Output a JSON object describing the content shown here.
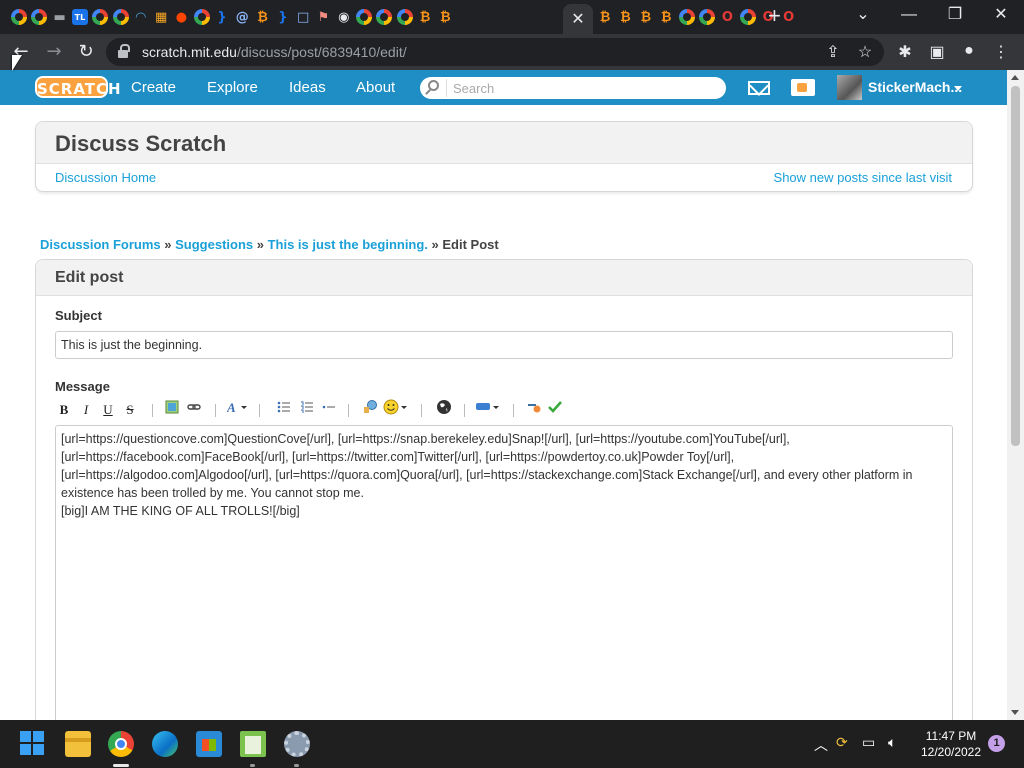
{
  "browser": {
    "url_host": "scratch.mit.edu",
    "url_path": "/discuss/post/6839410/edit/",
    "tabs": [
      {
        "icon": "google-icon"
      },
      {
        "icon": "google-icon"
      },
      {
        "icon": "monitor-icon"
      },
      {
        "icon": "tl-icon",
        "text": "TL"
      },
      {
        "icon": "google-icon"
      },
      {
        "icon": "google-icon"
      },
      {
        "icon": "wifi-icon"
      },
      {
        "icon": "grid-icon"
      },
      {
        "icon": "reddit-icon"
      },
      {
        "icon": "google-icon"
      },
      {
        "icon": "brace-icon"
      },
      {
        "icon": "at-icon"
      },
      {
        "icon": "bitcoin-icon"
      },
      {
        "icon": "brace-icon"
      },
      {
        "icon": "square-icon"
      },
      {
        "icon": "flag-icon"
      },
      {
        "icon": "chrome-icon"
      },
      {
        "icon": "google-icon"
      },
      {
        "icon": "google-icon"
      },
      {
        "icon": "google-icon"
      },
      {
        "icon": "bitcoin-icon"
      },
      {
        "icon": "bitcoin-icon"
      },
      {
        "icon": "bitcoin-icon"
      },
      {
        "icon": "bitcoin-icon"
      },
      {
        "icon": "bitcoin-icon"
      },
      {
        "icon": "bitcoin-icon"
      },
      {
        "icon": "google-icon"
      },
      {
        "icon": "google-icon"
      },
      {
        "icon": "opera-icon"
      },
      {
        "icon": "google-icon"
      },
      {
        "icon": "opera-icon"
      },
      {
        "icon": "opera-icon"
      }
    ]
  },
  "scratch_nav": {
    "logo_text": "SCRATCH",
    "links": [
      "Create",
      "Explore",
      "Ideas",
      "About"
    ],
    "search_placeholder": "Search",
    "username": "StickerMach..."
  },
  "discuss": {
    "title": "Discuss Scratch",
    "home_link": "Discussion Home",
    "new_posts_link": "Show new posts since last visit"
  },
  "breadcrumb": {
    "forums": "Discussion Forums",
    "sep": " » ",
    "category": "Suggestions",
    "topic": "This is just the beginning.",
    "current": " » Edit Post"
  },
  "edit_post": {
    "heading": "Edit post",
    "subject_label": "Subject",
    "subject_value": "This is just the beginning.",
    "message_label": "Message",
    "message_value": "[url=https://questioncove.com]QuestionCove[/url], [url=https://snap.berekeley.edu]Snap![/url], [url=https://youtube.com]YouTube[/url], [url=https://facebook.com]FaceBook[/url], [url=https://twitter.com]Twitter[/url], [url=https://powdertoy.co.uk]Powder Toy[/url], [url=https://algodoo.com]Algodoo[/url], [url=https://quora.com]Quora[/url], [url=https://stackexchange.com]Stack Exchange[/url], and every other platform in existence has been trolled by me. You cannot stop me.\n[big]I AM THE KING OF ALL TROLLS![/big]",
    "toolbar": {
      "bold": "B",
      "italic": "I",
      "underline": "U",
      "strike": "S"
    }
  },
  "taskbar": {
    "time": "11:47 PM",
    "date": "12/20/2022",
    "notification_count": "1"
  },
  "colors": {
    "scratch_blue": "#1e8ec4",
    "link_blue": "#1aa0d8",
    "scratch_orange": "#f9a23f"
  }
}
